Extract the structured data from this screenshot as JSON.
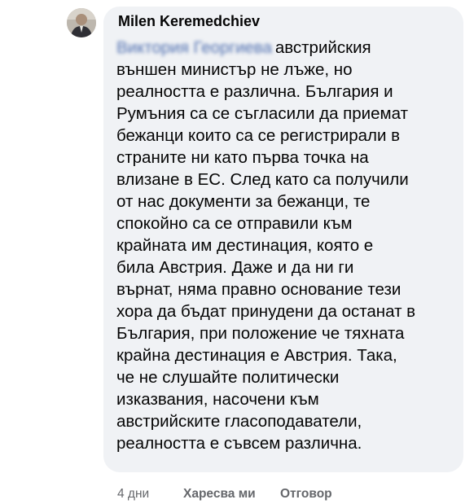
{
  "comment": {
    "author": "Milen Keremedchiev",
    "mention": "Виктория Георгиева",
    "lines": [
      "австрийския",
      "външен министър не лъже, но",
      "реалността е различна. България и",
      "Румъния са се съгласили да приемат",
      "бежанци които са се регистрирали в",
      "страните ни като първа точка на",
      "влизане в ЕС. След като са получили",
      "от нас документи за бежанци, те",
      "спокойно са се отправили към",
      "крайната им дестинация, която е",
      "била Австрия. Даже и да ни ги",
      "върнат, няма правно основание тези",
      "хора да бъдат принудени да останат в",
      "България, при положение че тяхната",
      "крайна дестинация е Австрия. Така,",
      "че не слушайте политически",
      "изказвания, насочени към",
      "австрийските гласоподаватели,",
      "реалността е съвсем различна."
    ],
    "time": "4 дни",
    "like_label": "Харесва ми",
    "reply_label": "Отговор"
  },
  "colors": {
    "bubble": "#f0f2f5",
    "text": "#050505",
    "secondary": "#65676b",
    "mention": "#4f6fb0"
  }
}
